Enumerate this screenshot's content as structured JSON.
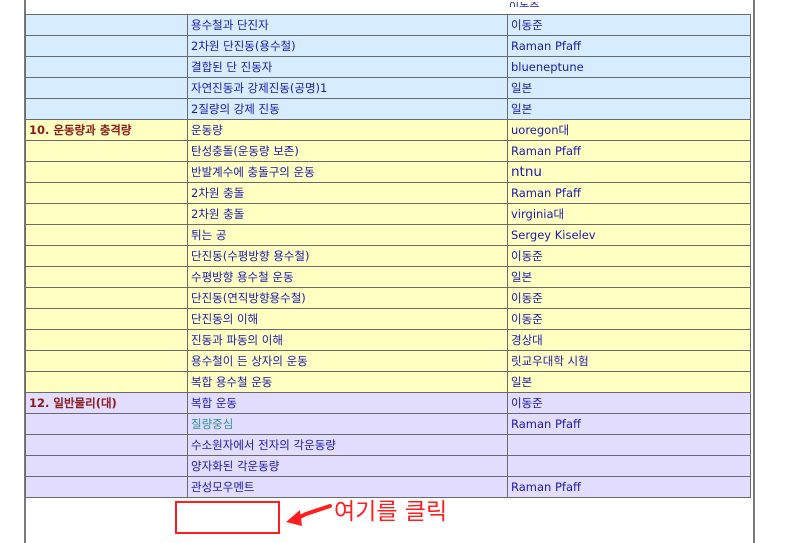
{
  "top_cut_fragment": "이동준",
  "rows": [
    {
      "theme": "blue",
      "section": "",
      "title": "용수철과 단진자",
      "source": "이동준"
    },
    {
      "theme": "blue",
      "section": "",
      "title": "2차원 단진동(용수철)",
      "source": "Raman Pfaff"
    },
    {
      "theme": "blue",
      "section": "",
      "title": "결합된 단 진동자",
      "source": "blueneptune"
    },
    {
      "theme": "blue",
      "section": "",
      "title": "자연진동과 강제진동(공명)1",
      "source": "일본"
    },
    {
      "theme": "blue",
      "section": "",
      "title": "2질량의 강제 진동",
      "source": "일본"
    },
    {
      "theme": "yellow",
      "section": "10. 운동량과 충격량",
      "title": "운동량",
      "source": "uoregon대"
    },
    {
      "theme": "yellow",
      "section": "",
      "title": "탄성충돌(운동량 보존)",
      "source": "Raman Pfaff"
    },
    {
      "theme": "yellow",
      "section": "",
      "title": "반발계수에 충돌구의 운동",
      "source": "ntnu",
      "tall": true,
      "bigSource": true
    },
    {
      "theme": "yellow",
      "section": "",
      "title": "2차원 충돌",
      "source": "Raman Pfaff"
    },
    {
      "theme": "yellow",
      "section": "",
      "title": "2차원 충돌",
      "source": "virginia대"
    },
    {
      "theme": "yellow",
      "section": "",
      "title": "튀는 공",
      "source": "Sergey Kiselev"
    },
    {
      "theme": "yellow",
      "section": "",
      "title": "단진동(수평방향 용수철)",
      "source": "이동준"
    },
    {
      "theme": "yellow",
      "section": "",
      "title": "수평방향 용수철 운동",
      "source": "일본"
    },
    {
      "theme": "yellow",
      "section": "",
      "title": "단진동(연직방향용수철)",
      "source": "이동준"
    },
    {
      "theme": "yellow",
      "section": "",
      "title": "단진동의 이해",
      "source": "이동준"
    },
    {
      "theme": "yellow",
      "section": "",
      "title": "진동과 파동의 이해",
      "source": "경상대"
    },
    {
      "theme": "yellow",
      "section": "",
      "title": "용수철이 든 상자의 운동",
      "source": "릿교우대학 시험"
    },
    {
      "theme": "yellow",
      "section": "",
      "title": "복합 용수철 운동",
      "source": "일본"
    },
    {
      "theme": "purple",
      "section": "12. 일반물리(대)",
      "title": "복합 운동",
      "source": "이동준"
    },
    {
      "theme": "purple",
      "section": "",
      "title": "질량중심",
      "source": "Raman Pfaff",
      "tealTitle": true
    },
    {
      "theme": "purple",
      "section": "",
      "title": "수소원자에서 전자의 각운동량",
      "source": ""
    },
    {
      "theme": "purple",
      "section": "",
      "title": "양자화된 각운동량",
      "source": ""
    },
    {
      "theme": "purple",
      "section": "",
      "title": "관성모우멘트",
      "source": "Raman Pfaff",
      "tall": true
    }
  ],
  "annotation": {
    "text": "여기를 클릭",
    "color": "#ff1e1e"
  },
  "colors": {
    "blue_row": "#d6ecff",
    "yellow_row": "#ffffc2",
    "purple_row": "#e2dcff",
    "section_text": "#8b1a1a",
    "link_text": "#1a1aaa",
    "teal_text": "#2e9090"
  }
}
